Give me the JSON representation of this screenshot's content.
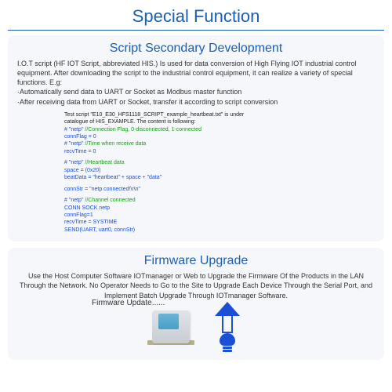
{
  "main_title": "Special Function",
  "script_dev": {
    "title": "Script Secondary Development",
    "intro": "I.O.T script (HF IOT Script, abbreviated HIS.) Is used for data conversion of High Flying IOT industrial control equipment. After downloading the script to the industrial control equipment, it can realize a variety of special functions. E.g:",
    "bullet1": "·Automatically send data to UART or Socket as Modbus master function",
    "bullet2": "·After receiving data from UART or Socket, transfer it according to script conversion",
    "code": {
      "l1a": "Test script  \"E10_E30_HFS1118_SCRIPT_example_heartbeat.txt\"  is under",
      "l1b": "catalogue of HIS_EXAMPLE. The content is following:",
      "l2": "# \"netp\"",
      "l2c": "  //Connection Flag, 0-disconnected, 1-connected",
      "l3": "connFlag = 0",
      "l4": "# \"netp\"",
      "l4c": "  //Time when receive data",
      "l5": "recvTime = 0",
      "l6": "# \"netp\"",
      "l6c": "  //Heartbeat data",
      "l7": "space = (0x20)",
      "l8": "beatData = \"heartbeat\" + space + \"data\"",
      "l9": "connStr = \"netp connected!\\r\\n\"",
      "l10": "# \"netp\"",
      "l10c": "  //Channel connected",
      "l11": "CONN SOCK netp",
      "l12": "connFlag=1",
      "l13": "recvTime = SYSTIME",
      "l14": "SEND(UART, uart0, connStr)"
    }
  },
  "firmware": {
    "title": "Firmware Upgrade",
    "body": "Use the Host Computer Software IOTmanager or Web to Upgrade the Firmware Of the Products in the LAN Through the Network. No Operator Needs to Go to the Site to Upgrade Each Device Through the Serial Port, and Implement Batch Upgrade Through IOTmanager Software.",
    "update_label": "Firmware Update......"
  }
}
